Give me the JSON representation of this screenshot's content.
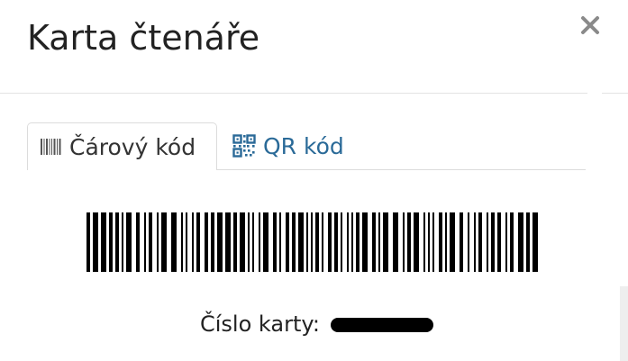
{
  "dialog": {
    "title": "Karta čtenáře",
    "close_icon": "close-icon"
  },
  "tabs": [
    {
      "label": "Čárový kód",
      "icon": "barcode-icon",
      "active": true
    },
    {
      "label": "QR kód",
      "icon": "qr-code-icon",
      "active": false
    }
  ],
  "card": {
    "number_label": "Číslo karty:",
    "number_value_redacted": true
  },
  "colors": {
    "link": "#2a6a98",
    "text": "#222222",
    "border": "#dcdcdc",
    "redaction": "#000000"
  }
}
